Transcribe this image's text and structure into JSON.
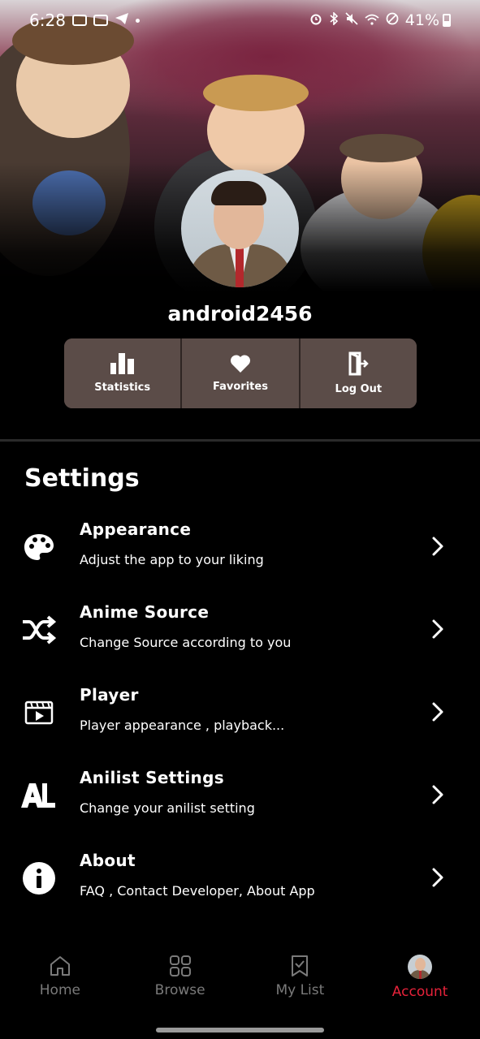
{
  "status_bar": {
    "time": "6:28",
    "battery": "41%"
  },
  "profile": {
    "username": "android2456"
  },
  "actions": [
    {
      "label": "Statistics",
      "icon": "bar-chart-icon"
    },
    {
      "label": "Favorites",
      "icon": "heart-icon"
    },
    {
      "label": "Log Out",
      "icon": "logout-door-icon"
    }
  ],
  "settings": {
    "title": "Settings",
    "items": [
      {
        "title": "Appearance",
        "subtitle": "Adjust the app to your liking",
        "icon": "palette-icon"
      },
      {
        "title": "Anime Source",
        "subtitle": "Change Source according to you",
        "icon": "shuffle-icon"
      },
      {
        "title": "Player",
        "subtitle": "Player appearance , playback...",
        "icon": "video-player-icon"
      },
      {
        "title": "Anilist Settings",
        "subtitle": "Change your anilist setting",
        "icon": "anilist-logo-icon"
      },
      {
        "title": "About",
        "subtitle": "FAQ , Contact Developer, About App",
        "icon": "info-icon"
      }
    ]
  },
  "bottom_nav": {
    "items": [
      {
        "label": "Home",
        "icon": "home-icon"
      },
      {
        "label": "Browse",
        "icon": "grid-icon"
      },
      {
        "label": "My List",
        "icon": "bookmark-icon"
      },
      {
        "label": "Account",
        "icon": "avatar"
      }
    ],
    "active": "Account"
  },
  "colors": {
    "accent": "#e6223a",
    "action_bg": "#5b4c48",
    "nav_inactive": "#7a7a7a"
  }
}
